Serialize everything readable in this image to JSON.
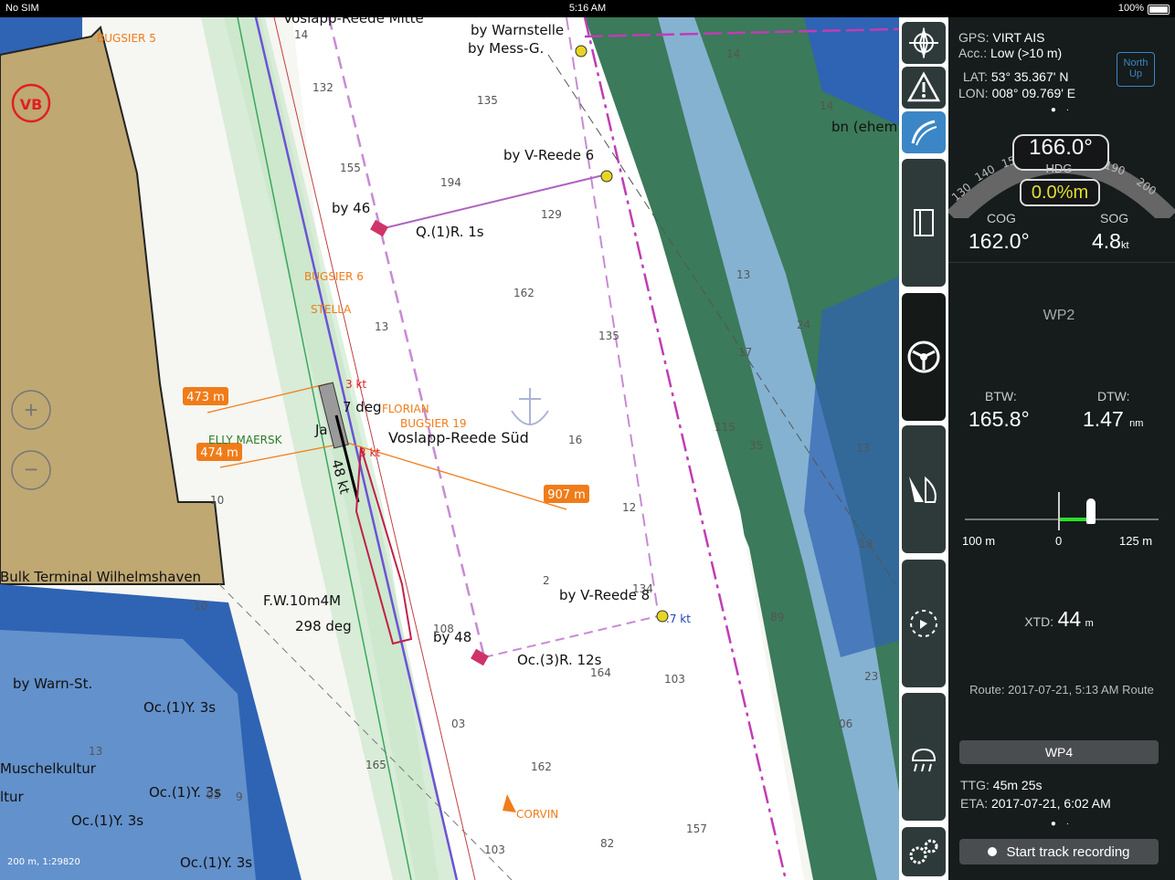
{
  "status": {
    "carrier": "No SIM",
    "time": "5:16 AM",
    "battery": "100%"
  },
  "map_labels": {
    "bugsier5": "BUGSIER 5",
    "vb": "VB",
    "voslapp_mitte": "Voslapp-Reede Mitte",
    "warnstelle1": "by Warnstelle",
    "warnstelle2": "by Mess-G.",
    "v_reede6": "by V-Reede 6",
    "by46": "by 46",
    "q1r": "Q.(1)R. 1s",
    "bugsier6": "BUGSIER 6",
    "stella": "STELLA",
    "florian": "FLORIAN",
    "bugsier19": "BUGSIER 19",
    "voslapp_sued": "Voslapp-Reede Süd",
    "elly": "ELLY MAERSK",
    "bulk": "Bulk Terminal Wilhelmshaven",
    "fw": "F.W.10m4M",
    "deg298": "298 deg",
    "by48": "by 48",
    "oc3r": "Oc.(3)R. 12s",
    "v_reede8": "by V-Reede 8",
    "warn_st": "by Warn-St.",
    "oc1y_a": "Oc.(1)Y. 3s",
    "oc1y_b": "Oc.(1)Y. 3s",
    "oc1y_c": "Oc.(1)Y. 3s",
    "oc1y_d": "Oc.(1)Y. 3s",
    "muschel": "Muschelkultur",
    "ltur": "ltur",
    "corvin": "CORVIN",
    "bn_ehem": "bn (ehem",
    "scale": "200 m, 1:29820",
    "deg7": "7 deg",
    "ja": "Ja",
    "kt48": "48 kt",
    "kt3a": "3 kt",
    "kt3b": "3 kt",
    "kt07": ".7 kt",
    "d473": "473 m",
    "d474": "474 m",
    "d907": "907 m"
  },
  "depths": [
    "14",
    "132",
    "135",
    "14",
    "155",
    "194",
    "129",
    "162",
    "135",
    "13",
    "13",
    "16",
    "14",
    "24",
    "17",
    "13",
    "12",
    "115",
    "35",
    "2",
    "134",
    "108",
    "164",
    "103",
    "89",
    "23",
    "06",
    "03",
    "165",
    "162",
    "157",
    "82",
    "103",
    "18",
    "10",
    "11",
    "19",
    "13",
    "10",
    "03",
    "9",
    "20"
  ],
  "toolbar": {
    "items": [
      "compass-rose-icon",
      "warning-icon",
      "route-icon",
      "chart-book-icon",
      "helm-icon",
      "sail-icon",
      "anchor-alarm-icon",
      "weather-icon",
      "settings-icon"
    ]
  },
  "panel": {
    "gps_label": "GPS:",
    "gps_value": "VIRT AIS",
    "acc_label": "Acc.:",
    "acc_value": "Low (>10 m)",
    "lat_label": "LAT:",
    "lat_value": "53° 35.367' N",
    "lon_label": "LON:",
    "lon_value": "008° 09.769' E",
    "north_up": "North Up",
    "hdg_value": "166.0°",
    "hdg_label": "HDG",
    "rot_value": "0.0%m",
    "compass_ticks": [
      "130",
      "140",
      "150",
      "190",
      "200"
    ],
    "cog_label": "COG",
    "cog_value": "162.0°",
    "sog_label": "SOG",
    "sog_value": "4.8",
    "sog_unit": "kt",
    "wp_current": "WP2",
    "btw_label": "BTW:",
    "btw_value": "165.8°",
    "dtw_label": "DTW:",
    "dtw_value": "1.47",
    "dtw_unit": "nm",
    "xte_left": "100 m",
    "xte_center": "0",
    "xte_right": "125 m",
    "xtd_label": "XTD:",
    "xtd_value": "44",
    "xtd_unit": "m",
    "route_info": "Route: 2017-07-21, 5:13 AM Route",
    "wp_next": "WP4",
    "ttg_label": "TTG:",
    "ttg_value": "45m 25s",
    "eta_label": "ETA:",
    "eta_value": "2017-07-21, 6:02 AM",
    "record_button": "Start track recording"
  },
  "colors": {
    "water_deep": "#2f63b4",
    "land": "#bfa872",
    "shallow": "#8eb8de",
    "green_fairway": "#d8ecd8",
    "panel": "#121416",
    "accent": "#3b86c6",
    "orange": "#f07c19",
    "magenta": "#b04bb8"
  }
}
